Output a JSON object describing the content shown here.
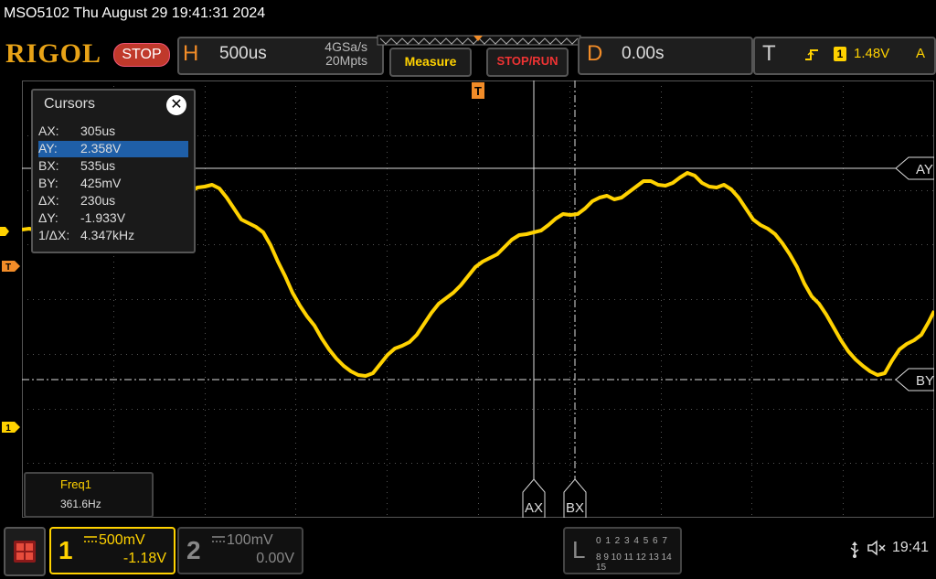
{
  "title": "MSO5102  Thu August 29 19:41:31 2024",
  "brand": "RIGOL",
  "run_state": "STOP",
  "horizontal": {
    "letter": "H",
    "timebase": "500us",
    "sample_rate": "4GSa/s",
    "memory_depth": "20Mpts"
  },
  "buttons": {
    "measure": "Measure",
    "stop_run": "STOP/RUN"
  },
  "delay": {
    "letter": "D",
    "value": "0.00s"
  },
  "trigger": {
    "letter": "T",
    "edge_icon": "rising-edge-icon",
    "channel": "1",
    "level": "1.48V",
    "mode": "A"
  },
  "cursors": {
    "title": "Cursors",
    "close": "✕",
    "rows": [
      {
        "key": "AX:",
        "value": "305us"
      },
      {
        "key": "AY:",
        "value": "2.358V"
      },
      {
        "key": "BX:",
        "value": "535us"
      },
      {
        "key": "BY:",
        "value": "425mV"
      },
      {
        "key": "ΔX:",
        "value": "230us"
      },
      {
        "key": "ΔY:",
        "value": "-1.933V"
      },
      {
        "key": "1/ΔX:",
        "value": "4.347kHz"
      }
    ],
    "selected_index": 1,
    "labels": {
      "ax": "AX",
      "bx": "BX",
      "ay": "AY",
      "by": "BY"
    }
  },
  "measurement": {
    "label": "Freq1",
    "value": "361.6Hz"
  },
  "markers": {
    "trigger": "T",
    "channel1": "1"
  },
  "channel1": {
    "number": "1",
    "scale": "500mV",
    "offset": "-1.18V"
  },
  "channel2": {
    "number": "2",
    "scale": "100mV",
    "offset": "0.00V"
  },
  "logic": {
    "letter": "L",
    "row1": "0 1 2 3  4 5 6 7",
    "row2": "8 9 10 11 12 13 14 15"
  },
  "status": {
    "clock": "19:41",
    "usb_icon": "usb-icon",
    "audio_icon": "speaker-muted-icon"
  },
  "colors": {
    "ch1": "#ffd200",
    "accent": "#f28c28",
    "stop": "#c0392b",
    "selected_row": "#1f5fa8"
  }
}
